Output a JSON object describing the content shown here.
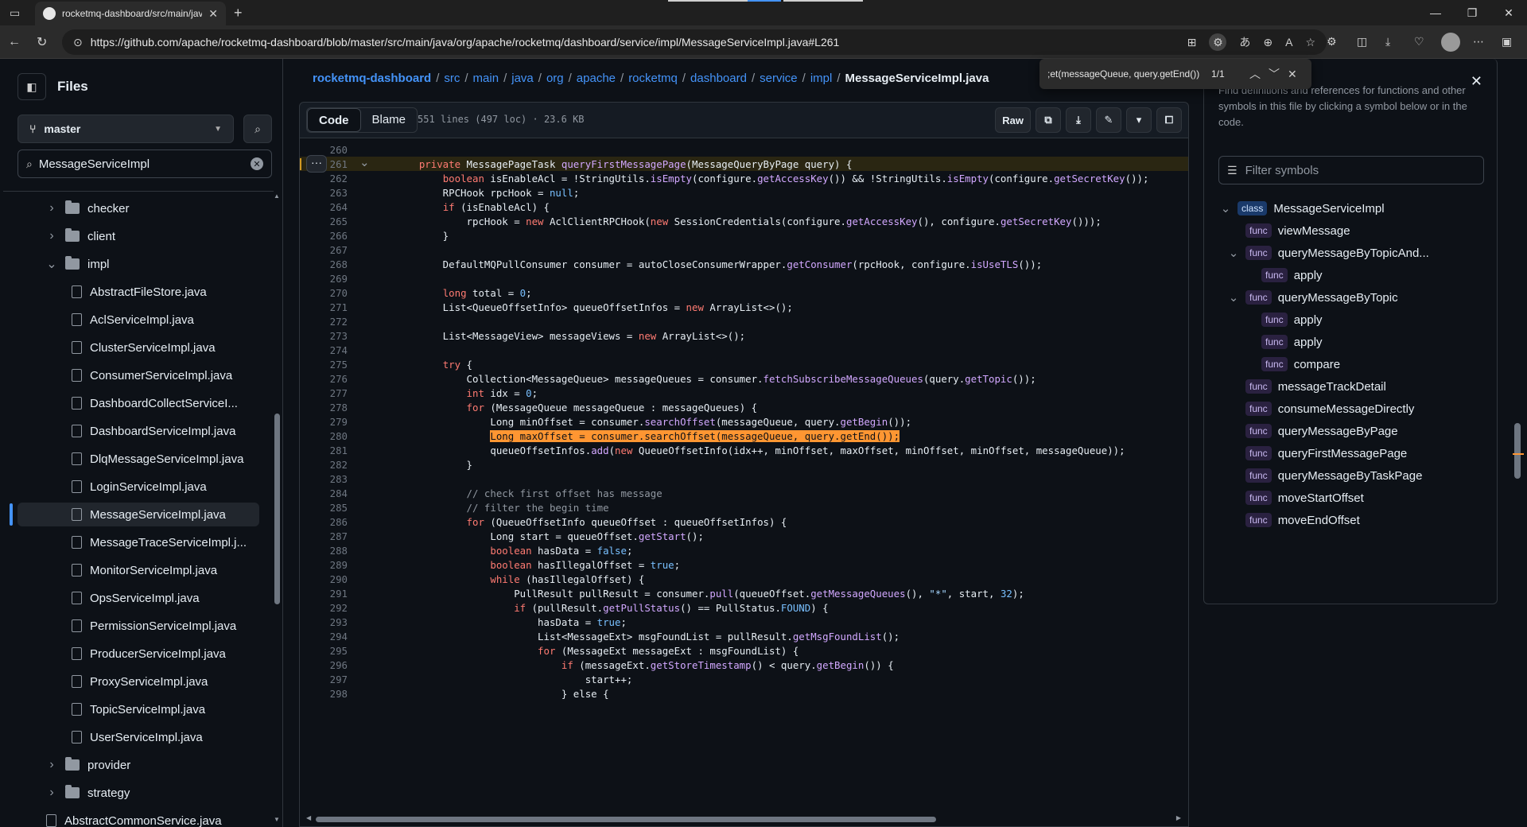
{
  "browser": {
    "tab_title": "rocketmq-dashboard/src/main/java",
    "url": "https://github.com/apache/rocketmq-dashboard/blob/master/src/main/java/org/apache/rocketmq/dashboard/service/impl/MessageServiceImpl.java#L261"
  },
  "sidebar": {
    "title": "Files",
    "branch": "master",
    "search_value": "MessageServiceImpl",
    "tree": [
      {
        "label": "checker",
        "type": "folder",
        "expanded": false,
        "depth": 0
      },
      {
        "label": "client",
        "type": "folder",
        "expanded": false,
        "depth": 0
      },
      {
        "label": "impl",
        "type": "folder",
        "expanded": true,
        "depth": 0
      },
      {
        "label": "AbstractFileStore.java",
        "type": "file",
        "depth": 1
      },
      {
        "label": "AclServiceImpl.java",
        "type": "file",
        "depth": 1
      },
      {
        "label": "ClusterServiceImpl.java",
        "type": "file",
        "depth": 1
      },
      {
        "label": "ConsumerServiceImpl.java",
        "type": "file",
        "depth": 1
      },
      {
        "label": "DashboardCollectServiceI...",
        "type": "file",
        "depth": 1
      },
      {
        "label": "DashboardServiceImpl.java",
        "type": "file",
        "depth": 1
      },
      {
        "label": "DlqMessageServiceImpl.java",
        "type": "file",
        "depth": 1
      },
      {
        "label": "LoginServiceImpl.java",
        "type": "file",
        "depth": 1
      },
      {
        "label": "MessageServiceImpl.java",
        "type": "file",
        "depth": 1,
        "selected": true
      },
      {
        "label": "MessageTraceServiceImpl.j...",
        "type": "file",
        "depth": 1
      },
      {
        "label": "MonitorServiceImpl.java",
        "type": "file",
        "depth": 1
      },
      {
        "label": "OpsServiceImpl.java",
        "type": "file",
        "depth": 1
      },
      {
        "label": "PermissionServiceImpl.java",
        "type": "file",
        "depth": 1
      },
      {
        "label": "ProducerServiceImpl.java",
        "type": "file",
        "depth": 1
      },
      {
        "label": "ProxyServiceImpl.java",
        "type": "file",
        "depth": 1
      },
      {
        "label": "TopicServiceImpl.java",
        "type": "file",
        "depth": 1
      },
      {
        "label": "UserServiceImpl.java",
        "type": "file",
        "depth": 1
      },
      {
        "label": "provider",
        "type": "folder",
        "expanded": false,
        "depth": 0
      },
      {
        "label": "strategy",
        "type": "folder",
        "expanded": false,
        "depth": 0
      },
      {
        "label": "AbstractCommonService.java",
        "type": "file",
        "depth": 0
      }
    ]
  },
  "breadcrumb": {
    "repo": "rocketmq-dashboard",
    "parts": [
      "src",
      "main",
      "java",
      "org",
      "apache",
      "rocketmq",
      "dashboard",
      "service",
      "impl"
    ],
    "file": "MessageServiceImpl.java"
  },
  "file_header": {
    "code_tab": "Code",
    "blame_tab": "Blame",
    "meta": "551 lines (497 loc) · 23.6 KB",
    "raw": "Raw"
  },
  "code": {
    "lines": [
      {
        "n": "260",
        "t": ""
      },
      {
        "n": "261",
        "t": "    private MessagePageTask queryFirstMessagePage(MessageQueryByPage query) {"
      },
      {
        "n": "262",
        "t": "        boolean isEnableAcl = !StringUtils.isEmpty(configure.getAccessKey()) && !StringUtils.isEmpty(configure.getSecretKey());"
      },
      {
        "n": "263",
        "t": "        RPCHook rpcHook = null;"
      },
      {
        "n": "264",
        "t": "        if (isEnableAcl) {"
      },
      {
        "n": "265",
        "t": "            rpcHook = new AclClientRPCHook(new SessionCredentials(configure.getAccessKey(), configure.getSecretKey()));"
      },
      {
        "n": "266",
        "t": "        }"
      },
      {
        "n": "267",
        "t": ""
      },
      {
        "n": "268",
        "t": "        DefaultMQPullConsumer consumer = autoCloseConsumerWrapper.getConsumer(rpcHook, configure.isUseTLS());"
      },
      {
        "n": "269",
        "t": ""
      },
      {
        "n": "270",
        "t": "        long total = 0;"
      },
      {
        "n": "271",
        "t": "        List<QueueOffsetInfo> queueOffsetInfos = new ArrayList<>();"
      },
      {
        "n": "272",
        "t": ""
      },
      {
        "n": "273",
        "t": "        List<MessageView> messageViews = new ArrayList<>();"
      },
      {
        "n": "274",
        "t": ""
      },
      {
        "n": "275",
        "t": "        try {"
      },
      {
        "n": "276",
        "t": "            Collection<MessageQueue> messageQueues = consumer.fetchSubscribeMessageQueues(query.getTopic());"
      },
      {
        "n": "277",
        "t": "            int idx = 0;"
      },
      {
        "n": "278",
        "t": "            for (MessageQueue messageQueue : messageQueues) {"
      },
      {
        "n": "279",
        "t": "                Long minOffset = consumer.searchOffset(messageQueue, query.getBegin());"
      },
      {
        "n": "280",
        "t": "                Long maxOffset = consumer.searchOffset(messageQueue, query.getEnd());"
      },
      {
        "n": "281",
        "t": "                queueOffsetInfos.add(new QueueOffsetInfo(idx++, minOffset, maxOffset, minOffset, minOffset, messageQueue));"
      },
      {
        "n": "282",
        "t": "            }"
      },
      {
        "n": "283",
        "t": ""
      },
      {
        "n": "284",
        "t": "            // check first offset has message"
      },
      {
        "n": "285",
        "t": "            // filter the begin time"
      },
      {
        "n": "286",
        "t": "            for (QueueOffsetInfo queueOffset : queueOffsetInfos) {"
      },
      {
        "n": "287",
        "t": "                Long start = queueOffset.getStart();"
      },
      {
        "n": "288",
        "t": "                boolean hasData = false;"
      },
      {
        "n": "289",
        "t": "                boolean hasIllegalOffset = true;"
      },
      {
        "n": "290",
        "t": "                while (hasIllegalOffset) {"
      },
      {
        "n": "291",
        "t": "                    PullResult pullResult = consumer.pull(queueOffset.getMessageQueues(), \"*\", start, 32);"
      },
      {
        "n": "292",
        "t": "                    if (pullResult.getPullStatus() == PullStatus.FOUND) {"
      },
      {
        "n": "293",
        "t": "                        hasData = true;"
      },
      {
        "n": "294",
        "t": "                        List<MessageExt> msgFoundList = pullResult.getMsgFoundList();"
      },
      {
        "n": "295",
        "t": "                        for (MessageExt messageExt : msgFoundList) {"
      },
      {
        "n": "296",
        "t": "                            if (messageExt.getStoreTimestamp() < query.getBegin()) {"
      },
      {
        "n": "297",
        "t": "                                start++;"
      },
      {
        "n": "298",
        "t": "                            } else {"
      }
    ]
  },
  "find": {
    "query": "et(messageQueue, query.getEnd());",
    "count": "1/1"
  },
  "symbols": {
    "description": "Find definitions and references for functions and other symbols in this file by clicking a symbol below or in the code.",
    "filter_placeholder": "Filter symbols",
    "items": [
      {
        "kind": "class",
        "name": "MessageServiceImpl",
        "depth": 0,
        "chevron": true
      },
      {
        "kind": "func",
        "name": "viewMessage",
        "depth": 1,
        "chevron": false
      },
      {
        "kind": "func",
        "name": "queryMessageByTopicAnd...",
        "depth": 1,
        "chevron": true
      },
      {
        "kind": "func",
        "name": "apply",
        "depth": 2,
        "chevron": false
      },
      {
        "kind": "func",
        "name": "queryMessageByTopic",
        "depth": 1,
        "chevron": true
      },
      {
        "kind": "func",
        "name": "apply",
        "depth": 2,
        "chevron": false
      },
      {
        "kind": "func",
        "name": "apply",
        "depth": 2,
        "chevron": false
      },
      {
        "kind": "func",
        "name": "compare",
        "depth": 2,
        "chevron": false
      },
      {
        "kind": "func",
        "name": "messageTrackDetail",
        "depth": 1,
        "chevron": false
      },
      {
        "kind": "func",
        "name": "consumeMessageDirectly",
        "depth": 1,
        "chevron": false
      },
      {
        "kind": "func",
        "name": "queryMessageByPage",
        "depth": 1,
        "chevron": false
      },
      {
        "kind": "func",
        "name": "queryFirstMessagePage",
        "depth": 1,
        "chevron": false
      },
      {
        "kind": "func",
        "name": "queryMessageByTaskPage",
        "depth": 1,
        "chevron": false
      },
      {
        "kind": "func",
        "name": "moveStartOffset",
        "depth": 1,
        "chevron": false
      },
      {
        "kind": "func",
        "name": "moveEndOffset",
        "depth": 1,
        "chevron": false
      }
    ]
  },
  "colors": {
    "accent": "#4493f8",
    "match": "#ff9632",
    "keyword": "#ff7b72",
    "method": "#d2a8ff",
    "constant": "#79c0ff",
    "comment": "#9198a1"
  }
}
